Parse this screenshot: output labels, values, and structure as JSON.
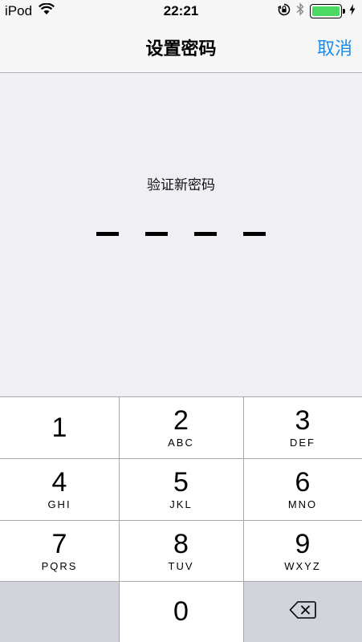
{
  "status_bar": {
    "carrier": "iPod",
    "time": "22:21",
    "icons": [
      "wifi-icon",
      "orientation-lock-icon",
      "bluetooth-icon",
      "battery-icon",
      "charging-icon"
    ],
    "battery_fill_percent": 100,
    "battery_color": "#4cd964"
  },
  "nav": {
    "title": "设置密码",
    "cancel_label": "取消",
    "accent_color": "#1a8cf0"
  },
  "passcode": {
    "prompt": "验证新密码",
    "digits_total": 4,
    "digits_entered": 0
  },
  "keypad": {
    "keys": [
      {
        "num": "1",
        "letters": ""
      },
      {
        "num": "2",
        "letters": "ABC"
      },
      {
        "num": "3",
        "letters": "DEF"
      },
      {
        "num": "4",
        "letters": "GHI"
      },
      {
        "num": "5",
        "letters": "JKL"
      },
      {
        "num": "6",
        "letters": "MNO"
      },
      {
        "num": "7",
        "letters": "PQRS"
      },
      {
        "num": "8",
        "letters": "TUV"
      },
      {
        "num": "9",
        "letters": "WXYZ"
      },
      {
        "num": "0",
        "letters": ""
      }
    ],
    "delete_icon": "backspace-icon"
  }
}
